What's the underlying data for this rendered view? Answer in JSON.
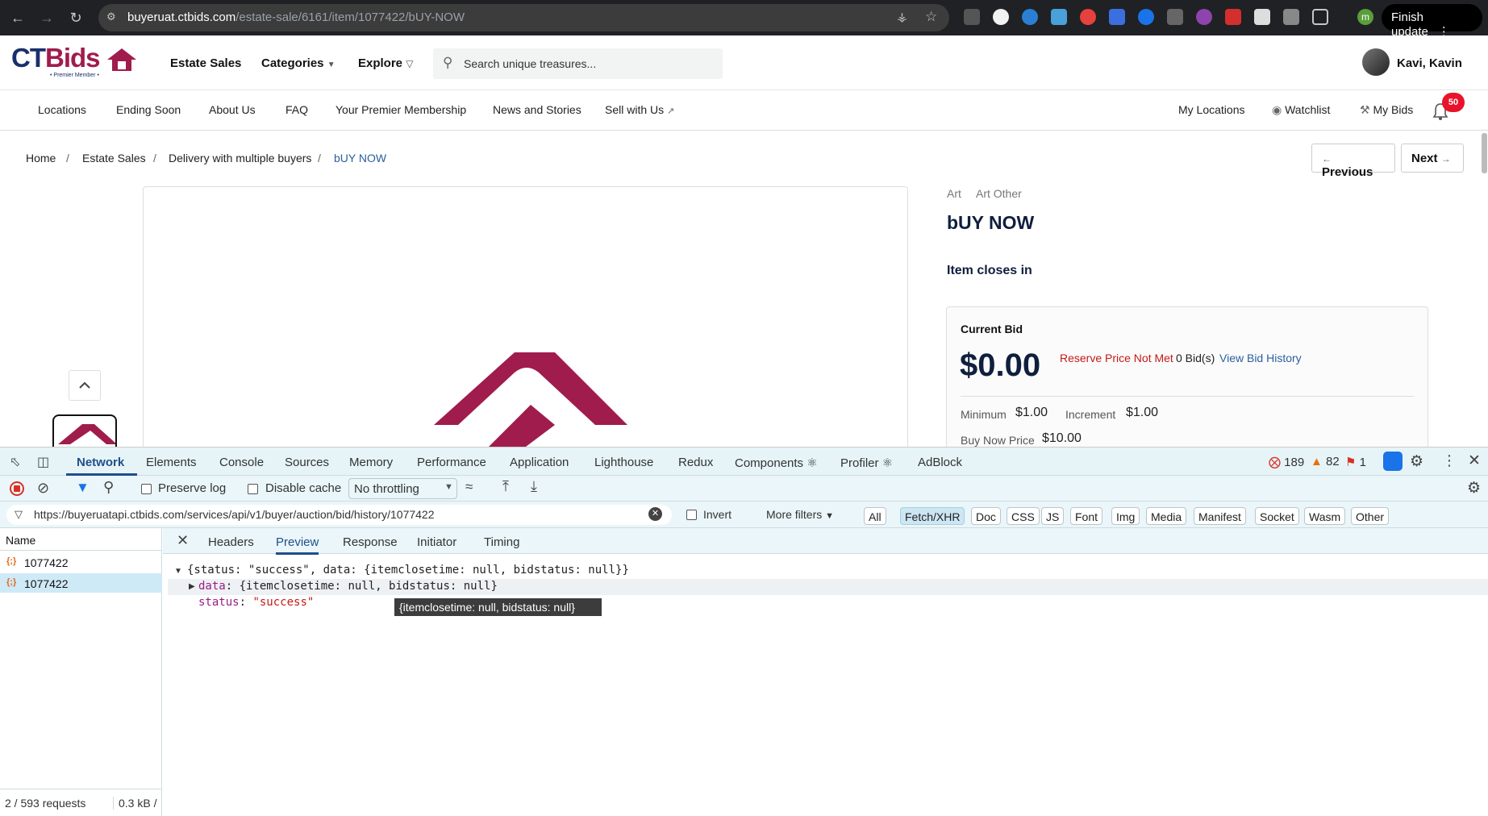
{
  "browser": {
    "url_host": "buyeruat.ctbids.com",
    "url_path": "/estate-sale/6161/item/1077422/bUY-NOW",
    "finish_update": "Finish update",
    "profile_initial": "m"
  },
  "header": {
    "logo": "CTBids",
    "logo_sub": "• Premier Member •",
    "nav": [
      "Estate Sales",
      "Categories",
      "Explore"
    ],
    "search_placeholder": "Search unique treasures...",
    "user_name": "Kavi, Kavin"
  },
  "subnav": {
    "left": [
      "Locations",
      "Ending Soon",
      "About Us",
      "FAQ",
      "Your Premier Membership",
      "News and Stories",
      "Sell with Us"
    ],
    "right": [
      "My Locations",
      "Watchlist",
      "My Bids"
    ],
    "notification_count": "50"
  },
  "breadcrumb": [
    "Home",
    "Estate Sales",
    "Delivery with multiple buyers",
    "bUY NOW"
  ],
  "pager": {
    "previous": "Previous",
    "next": "Next"
  },
  "item": {
    "categories": [
      "Art",
      "Art Other"
    ],
    "title": "bUY NOW",
    "closes_label": "Item closes in",
    "current_bid_label": "Current Bid",
    "current_bid": "$0.00",
    "reserve_status": "Reserve Price Not Met",
    "bid_count": "0 Bid(s)",
    "view_history": "View Bid History",
    "minimum_label": "Minimum",
    "minimum": "$1.00",
    "increment_label": "Increment",
    "increment": "$1.00",
    "buy_now_label": "Buy Now Price",
    "buy_now": "$10.00"
  },
  "devtools": {
    "tabs": [
      "Network",
      "Elements",
      "Console",
      "Sources",
      "Memory",
      "Performance",
      "Application",
      "Lighthouse",
      "Redux",
      "Components ⚛",
      "Profiler ⚛",
      "AdBlock"
    ],
    "errors": "189",
    "warnings": "82",
    "issues": "1",
    "preserve_log": "Preserve log",
    "disable_cache": "Disable cache",
    "throttling": "No throttling",
    "filter_value": "https://buyeruatapi.ctbids.com/services/api/v1/buyer/auction/bid/history/1077422",
    "invert": "Invert",
    "more_filters": "More filters",
    "types": [
      "All",
      "Fetch/XHR",
      "Doc",
      "CSS",
      "JS",
      "Font",
      "Img",
      "Media",
      "Manifest",
      "Socket",
      "Wasm",
      "Other"
    ],
    "name_header": "Name",
    "requests": [
      "1077422",
      "1077422"
    ],
    "status_bar": "2 / 593 requests",
    "transfer": "0.3 kB /",
    "subtabs": [
      "Headers",
      "Preview",
      "Response",
      "Initiator",
      "Timing"
    ],
    "preview_root": "{status: \"success\", data: {itemclosetime: null, bidstatus: null}}",
    "preview_data_key": "data",
    "preview_data_val": "{itemclosetime: null, bidstatus: null}",
    "preview_status_key": "status",
    "preview_status_val": "\"success\"",
    "tooltip": "{itemclosetime: null, bidstatus: null}"
  },
  "colors": {
    "brand_navy": "#1b2f6b",
    "brand_maroon": "#a01c4c",
    "reserve_red": "#c41a16",
    "link_blue": "#2b5f9e"
  }
}
